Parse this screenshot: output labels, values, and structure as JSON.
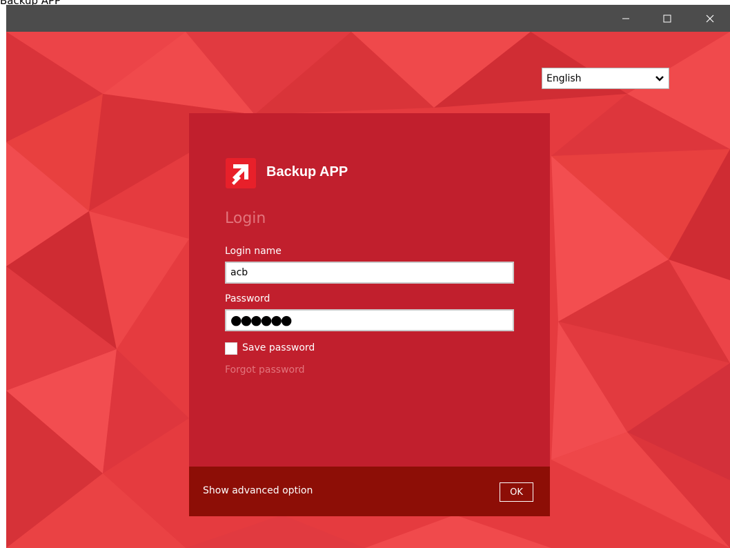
{
  "window": {
    "title": "Backup APP"
  },
  "language": {
    "selected": "English",
    "chevron_icon": "chevron-down-icon"
  },
  "login": {
    "brand_name": "Backup APP",
    "heading": "Login",
    "login_name_label": "Login name",
    "login_name_value": "acb",
    "password_label": "Password",
    "password_masked": "●●●●●●",
    "save_password_label": "Save password",
    "save_password_checked": false,
    "forgot_password_label": "Forgot password"
  },
  "footer": {
    "advanced_option_label": "Show advanced option",
    "ok_label": "OK"
  },
  "colors": {
    "background": "#e53b3f",
    "panel": "#c11f2d",
    "footer": "#8d0e06",
    "titlebar": "#4c4c4c",
    "muted_text": "#e2747c"
  }
}
